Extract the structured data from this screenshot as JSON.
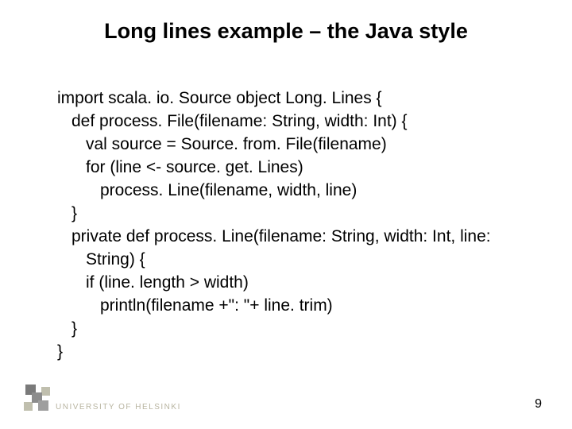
{
  "title": "Long lines example – the Java style",
  "code": {
    "l0": "import scala. io. Source object Long. Lines {",
    "l1": "def process. File(filename: String, width: Int) {",
    "l2": "val source = Source. from. File(filename)",
    "l3": "for (line <- source. get. Lines)",
    "l4": "process. Line(filename, width, line)",
    "l5": "}",
    "l6": "private def process. Line(filename: String, width: Int, line:",
    "l7": "String) {",
    "l8": "if (line. length > width)",
    "l9": "println(filename +\": \"+ line. trim)",
    "l10": "}",
    "l11": "}"
  },
  "footer": {
    "university": "UNIVERSITY OF HELSINKI",
    "page": "9"
  }
}
